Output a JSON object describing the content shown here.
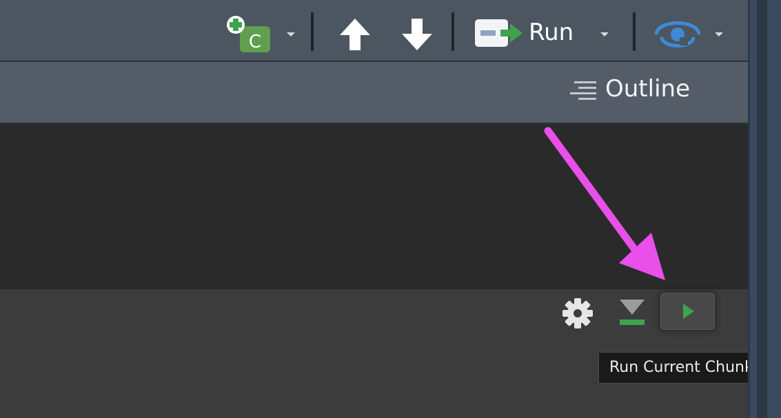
{
  "toolbar": {
    "insert_chunk_letter": "C",
    "insert_chunk_icon": "insert-chunk-icon",
    "go_up_icon": "arrow-up-icon",
    "go_down_icon": "arrow-down-icon",
    "run_icon": "run-code-icon",
    "run_label": "Run",
    "publish_icon": "publish-icon"
  },
  "outline": {
    "icon": "outline-lines-icon",
    "label": "Outline"
  },
  "chunk_toolbar": {
    "settings_icon": "gear-icon",
    "run_above_icon": "run-previous-chunks-icon",
    "run_chunk_icon": "play-icon"
  },
  "tooltip": {
    "text": "Run Current Chunk"
  },
  "annotation": {
    "arrow_color": "#e94fe9"
  },
  "colors": {
    "accent_green": "#3fa34d",
    "publish_blue": "#3f8ad6"
  }
}
